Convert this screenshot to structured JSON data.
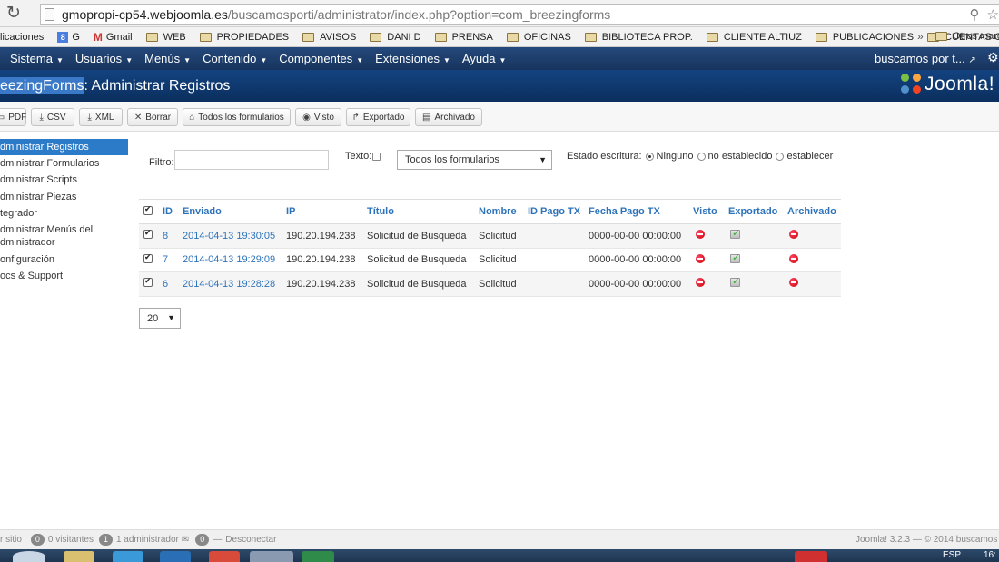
{
  "browser": {
    "url_host": "gmopropi-cp54.webjoomla.es",
    "url_path": "/buscamosporti/administrator/index.php?option=com_breezingforms",
    "bookmarks": [
      "licaciones",
      "G",
      "Gmail",
      "WEB",
      "PROPIEDADES",
      "AVISOS",
      "DANI D",
      "PRENSA",
      "OFICINAS",
      "BIBLIOTECA PROP.",
      "CLIENTE ALTIUZ",
      "PUBLICACIONES",
      "CUENTAS CLARAS"
    ],
    "bookmarks_more": "»",
    "other_bookmarks": "Otros marc"
  },
  "topmenu": {
    "items": [
      "Sistema",
      "Usuarios",
      "Menús",
      "Contenido",
      "Componentes",
      "Extensiones",
      "Ayuda"
    ],
    "site_link": "buscamos por t..."
  },
  "header": {
    "title_highlight": "eezingForms",
    "title_rest": ": Administrar Registros",
    "logo_text": "Joomla!"
  },
  "toolbar": {
    "buttons": [
      "PDF",
      "CSV",
      "XML",
      "Borrar",
      "Todos los formularios",
      "Visto",
      "Exportado",
      "Archivado"
    ]
  },
  "sidebar": {
    "items": [
      "dministrar Registros",
      "dministrar Formularios",
      "dministrar Scripts",
      "dministrar Piezas",
      "tegrador",
      "dministrar Menús del dministrador",
      "onfiguración",
      "ocs & Support"
    ]
  },
  "filters": {
    "filtro_label": "Filtro:",
    "filtro_value": "",
    "texto_label": "Texto:",
    "form_select": "Todos los formularios",
    "estado_label": "Estado escritura:",
    "estado_options": [
      "Ninguno",
      "no establecido",
      "establecer"
    ],
    "estado_selected": "Ninguno"
  },
  "table": {
    "columns": [
      "ID",
      "Enviado",
      "IP",
      "Título",
      "Nombre",
      "ID Pago TX",
      "Fecha Pago TX",
      "Visto",
      "Exportado",
      "Archivado"
    ],
    "rows": [
      {
        "id": "8",
        "enviado": "2014-04-13 19:30:05",
        "ip": "190.20.194.238",
        "titulo": "Solicitud de Busqueda",
        "nombre": "Solicitud",
        "id_pago": "",
        "fecha_pago": "0000-00-00 00:00:00"
      },
      {
        "id": "7",
        "enviado": "2014-04-13 19:29:09",
        "ip": "190.20.194.238",
        "titulo": "Solicitud de Busqueda",
        "nombre": "Solicitud",
        "id_pago": "",
        "fecha_pago": "0000-00-00 00:00:00"
      },
      {
        "id": "6",
        "enviado": "2014-04-13 19:28:28",
        "ip": "190.20.194.238",
        "titulo": "Solicitud de Busqueda",
        "nombre": "Solicitud",
        "id_pago": "",
        "fecha_pago": "0000-00-00 00:00:00"
      }
    ]
  },
  "pagination": {
    "limit": "20"
  },
  "statusbar": {
    "ver_sitio": "r sitio",
    "visitors_count": "0",
    "visitors_label": "0 visitantes",
    "admin_count": "1",
    "admin_label": "1 administrador",
    "msg_count": "0",
    "logout": "Desconectar",
    "right_text": "Joomla! 3.2.3 — © 2014 buscamos p"
  },
  "taskbar": {
    "lang": "ESP",
    "time": "16:"
  },
  "colors": {
    "topmenu": "#1b3c68",
    "header": "#0f3a71",
    "link": "#2d73bb",
    "active": "#2b7bc8"
  }
}
